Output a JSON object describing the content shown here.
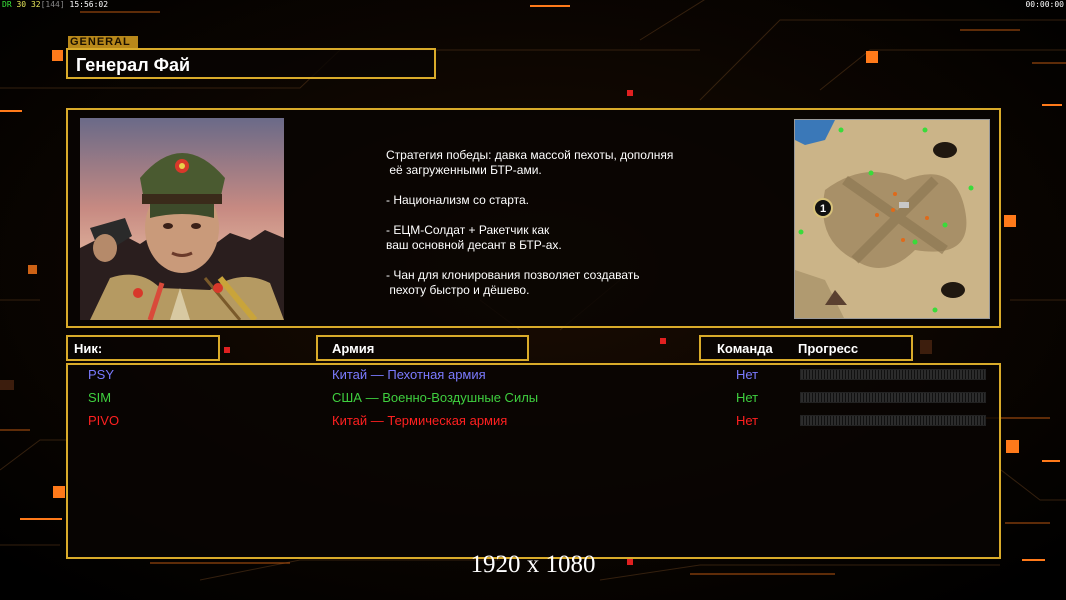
{
  "hud": {
    "prefix": "DR",
    "fps": "30",
    "fps2": "32",
    "bracket": "[144]",
    "clock": "15:56:02",
    "timer": "00:00:00"
  },
  "general": {
    "tag": "GENERAL",
    "name": "Генерал Фай",
    "description": "Стратегия победы: давка массой пехоты, дополняя\n её загруженными БТР-ами.\n\n- Национализм со старта.\n\n- ЕЦМ-Солдат + Ракетчик как\nваш основной десант в БТР-ах.\n\n- Чан для клонирования позволяет создавать\n пехоту быстро и дёшево."
  },
  "minimap": {
    "start_marker": "1"
  },
  "columns": {
    "nick": "Ник:",
    "army": "Армия",
    "team": "Команда",
    "progress": "Прогресс"
  },
  "players": [
    {
      "name": "PSY",
      "army": "Китай — Пехотная армия",
      "team": "Нет",
      "color": "#7b7bff",
      "progress": 0
    },
    {
      "name": "SIM",
      "army": "США — Военно-Воздушные Силы",
      "team": "Нет",
      "color": "#3fcf3f",
      "progress": 0
    },
    {
      "name": "PIVO",
      "army": "Китай — Термическая армия",
      "team": "Нет",
      "color": "#ff2020",
      "progress": 0
    }
  ],
  "resolution_label": "1920 x 1080",
  "colors": {
    "frame": "#d9ab2a",
    "accent_orange": "#ff7a1a"
  }
}
